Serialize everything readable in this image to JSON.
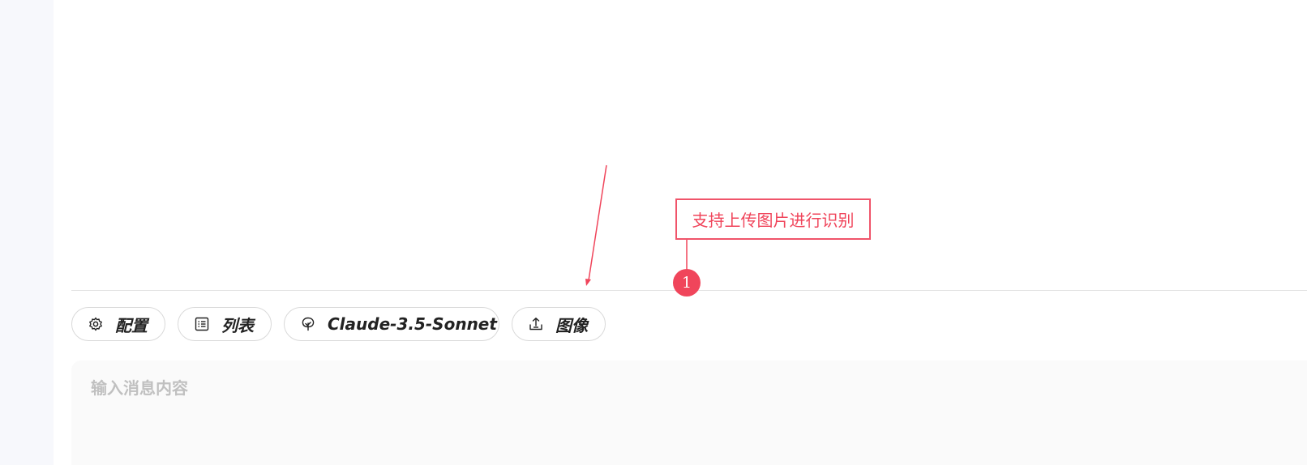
{
  "toolbar": {
    "config_label": "配置",
    "list_label": "列表",
    "model_label": "Claude-3.5-Sonnet",
    "image_label": "图像"
  },
  "input": {
    "placeholder": "输入消息内容",
    "value": ""
  },
  "annotation": {
    "callout_text": "支持上传图片进行识别",
    "badge_number": "1",
    "color": "#f0455b"
  },
  "icons": {
    "config": "gear-icon",
    "list": "list-icon",
    "model": "leaf-icon",
    "image": "upload-icon"
  }
}
